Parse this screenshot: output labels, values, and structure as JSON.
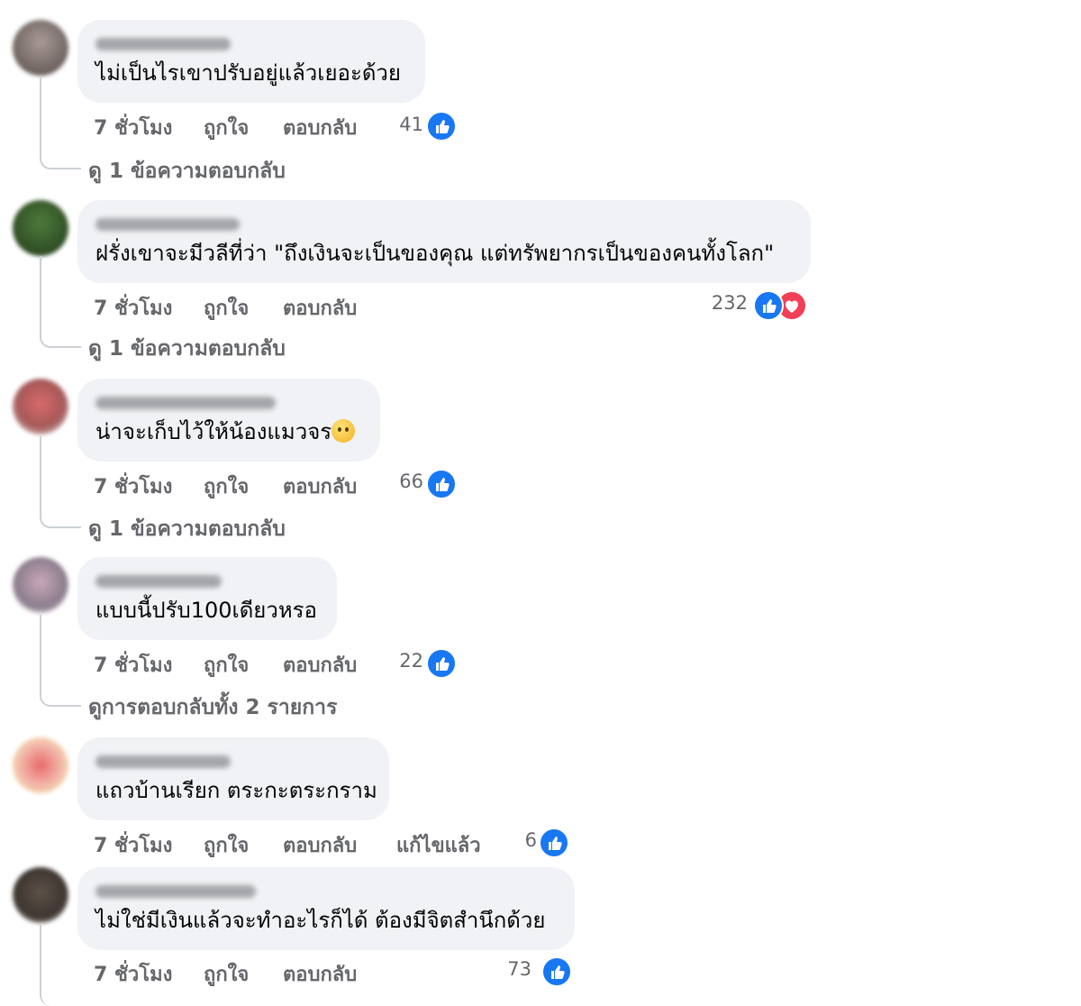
{
  "colors": {
    "like": "#1877f2",
    "love": "#f33e58",
    "bubble": "#f0f2f5",
    "meta": "#65676b"
  },
  "labels": {
    "time": "7 ชั่วโมง",
    "like": "ถูกใจ",
    "reply": "ตอบกลับ",
    "edited": "แก้ไขแล้ว"
  },
  "comments": [
    {
      "text": "ไม่เป็นไรเขาปรับอยู่แล้วเยอะด้วย",
      "reaction_count": "41",
      "reactions": [
        "like-icon"
      ],
      "view_replies": "ดู 1 ข้อความตอบกลับ"
    },
    {
      "text": "ฝรั่งเขาจะมีวลีที่ว่า \"ถึงเงินจะเป็นของคุณ แต่ทรัพยากรเป็นของคนทั้งโลก\"",
      "reaction_count": "232",
      "reactions": [
        "like-icon",
        "heart-icon"
      ],
      "view_replies": "ดู 1 ข้อความตอบกลับ"
    },
    {
      "text": "น่าจะเก็บไว้ให้น้องแมวจร",
      "emoji": "sad-face-emoji",
      "reaction_count": "66",
      "reactions": [
        "like-icon"
      ],
      "view_replies": "ดู 1 ข้อความตอบกลับ"
    },
    {
      "text": "แบบนี้ปรับ100เดียวหรอ",
      "reaction_count": "22",
      "reactions": [
        "like-icon"
      ],
      "view_replies": "ดูการตอบกลับทั้ง 2 รายการ"
    },
    {
      "text": "แถวบ้านเรียก ตระกะตระกราม",
      "reaction_count": "6",
      "reactions": [
        "like-icon"
      ],
      "edited": true
    },
    {
      "text": "ไม่ใช่มีเงินแล้วจะทำอะไรก็ได้ ต้องมีจิตสำนึกด้วย",
      "reaction_count": "73",
      "reactions": [
        "like-icon"
      ]
    }
  ]
}
